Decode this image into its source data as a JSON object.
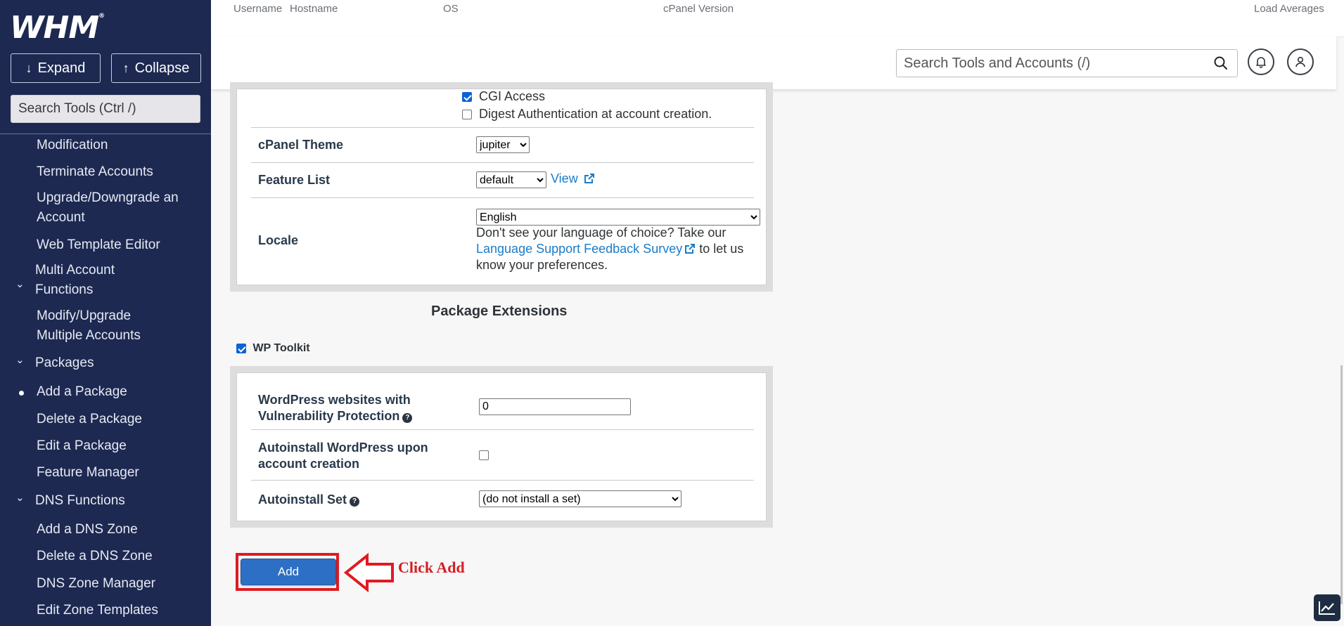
{
  "app": {
    "logo_text": "WHM",
    "logo_mark": "®"
  },
  "sidebar": {
    "expand_label": "Expand",
    "collapse_label": "Collapse",
    "search_placeholder": "Search Tools (Ctrl /)",
    "items": [
      {
        "label": "Modification",
        "kind": "link"
      },
      {
        "label": "Terminate Accounts",
        "kind": "link"
      },
      {
        "label": "Upgrade/Downgrade an Account",
        "kind": "link"
      },
      {
        "label": "Web Template Editor",
        "kind": "link"
      },
      {
        "label": "Multi Account Functions",
        "kind": "group"
      },
      {
        "label": "Modify/Upgrade Multiple Accounts",
        "kind": "link"
      },
      {
        "label": "Packages",
        "kind": "group"
      },
      {
        "label": "Add a Package",
        "kind": "link",
        "active": true
      },
      {
        "label": "Delete a Package",
        "kind": "link"
      },
      {
        "label": "Edit a Package",
        "kind": "link"
      },
      {
        "label": "Feature Manager",
        "kind": "link"
      },
      {
        "label": "DNS Functions",
        "kind": "group"
      },
      {
        "label": "Add a DNS Zone",
        "kind": "link"
      },
      {
        "label": "Delete a DNS Zone",
        "kind": "link"
      },
      {
        "label": "DNS Zone Manager",
        "kind": "link"
      },
      {
        "label": "Edit Zone Templates",
        "kind": "link"
      }
    ]
  },
  "info_bar": {
    "username": "Username",
    "hostname": "Hostname",
    "os": "OS",
    "cpanel_version": "cPanel Version",
    "load_averages": "Load Averages"
  },
  "header": {
    "search_placeholder": "Search Tools and Accounts (/)"
  },
  "form": {
    "cgi_access_label": "CGI Access",
    "cgi_access_checked": true,
    "digest_auth_label": "Digest Authentication at account creation.",
    "digest_auth_checked": false,
    "cpanel_theme": {
      "label": "cPanel Theme",
      "value": "jupiter"
    },
    "feature_list": {
      "label": "Feature List",
      "value": "default",
      "view_label": "View"
    },
    "locale": {
      "label": "Locale",
      "value": "English",
      "note_before": "Don't see your language of choice? Take our",
      "survey_link": "Language Support Feedback Survey",
      "note_after": "to let us know your preferences."
    }
  },
  "extensions": {
    "heading": "Package Extensions",
    "wp_toolkit_label": "WP Toolkit",
    "wp_toolkit_checked": true,
    "vuln_protection": {
      "label_line1": "WordPress websites with",
      "label_line2": "Vulnerability Protection",
      "value": "0"
    },
    "autoinstall": {
      "label_line1": "Autoinstall WordPress upon",
      "label_line2": "account creation",
      "checked": false
    },
    "autoinstall_set": {
      "label": "Autoinstall Set",
      "value": "(do not install a set)"
    }
  },
  "actions": {
    "add_label": "Add"
  },
  "annotation": {
    "callout_text": "Click Add",
    "color": "#e01a22"
  },
  "colors": {
    "sidebar_bg": "#1d2951",
    "link": "#1a7cc9",
    "primary_button": "#2d6fc4"
  }
}
